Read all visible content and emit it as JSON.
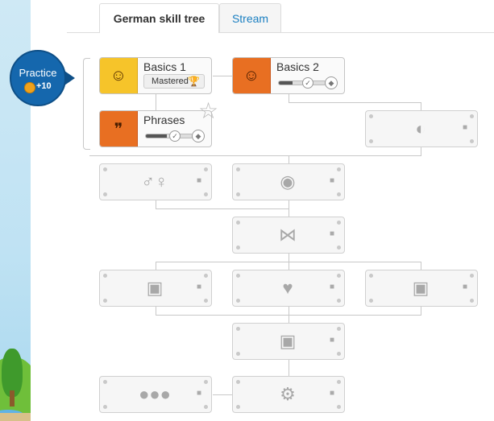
{
  "tabs": {
    "skill_tree": "German skill tree",
    "stream": "Stream"
  },
  "practice": {
    "label": "Practice",
    "bonus": "+10"
  },
  "skills": {
    "basics1": {
      "title": "Basics 1",
      "status": "Mastered"
    },
    "basics2": {
      "title": "Basics 2",
      "progress": 0.3
    },
    "phrases": {
      "title": "Phrases",
      "progress": 0.45
    }
  },
  "locked_skills": {
    "food": {
      "icon": "pizza-icon"
    },
    "gender": {
      "icon": "gender-symbols-icon"
    },
    "balloons": {
      "icon": "balloons-icon"
    },
    "clothing": {
      "icon": "bow-tie-icon"
    },
    "left_frame": {
      "icon": "picture-frame-icon"
    },
    "animals": {
      "icon": "whale-icon"
    },
    "right_frame": {
      "icon": "picture-frame-icon"
    },
    "middle_frame": {
      "icon": "picture-frame-icon"
    },
    "people": {
      "icon": "people-icon"
    },
    "settings": {
      "icon": "gear-icon"
    }
  },
  "colors": {
    "gold": "#f6c42a",
    "orange": "#e86f22",
    "practice_blue": "#1567ad",
    "tab_link": "#1a7fc1"
  }
}
